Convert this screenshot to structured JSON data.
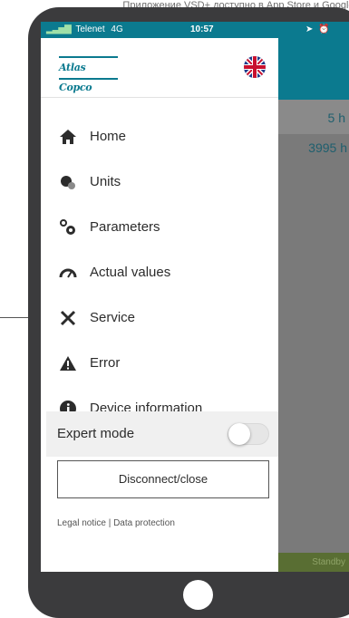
{
  "caption": "Приложение VSD+ доступно в App Store и Google Play",
  "status_bar": {
    "carrier": "Telenet",
    "network": "4G",
    "time": "10:57",
    "icons": [
      "location-icon",
      "alarm-icon",
      "battery-icon"
    ]
  },
  "brand": {
    "logo_text": "Atlas Copco",
    "language_flag": "uk-flag-icon"
  },
  "menu": {
    "items": [
      {
        "label": "Home",
        "icon": "home-icon"
      },
      {
        "label": "Units",
        "icon": "units-icon"
      },
      {
        "label": "Parameters",
        "icon": "parameters-icon"
      },
      {
        "label": "Actual values",
        "icon": "gauge-icon"
      },
      {
        "label": "Service",
        "icon": "tools-icon"
      },
      {
        "label": "Error",
        "icon": "warning-icon"
      },
      {
        "label": "Device information",
        "icon": "info-icon"
      }
    ],
    "expert_mode": {
      "label": "Expert mode",
      "enabled": false
    },
    "disconnect_label": "Disconnect/close",
    "legal_text": "Legal notice | Data protection"
  },
  "background_screen": {
    "row1_value": "5 h",
    "row2_value": "3995 h",
    "status_text": "Standby"
  },
  "colors": {
    "accent": "#0b7a8f",
    "status_bar": "#0b7a8f",
    "standby_bar": "#596e33",
    "device_frame": "#3b3b3d"
  }
}
